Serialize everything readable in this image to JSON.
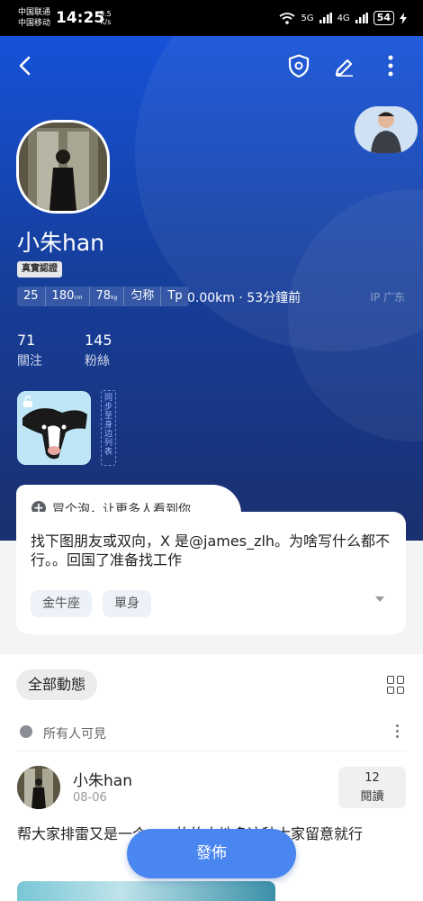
{
  "status_bar": {
    "carrier_1": "中国联通",
    "carrier_2": "中国移动",
    "time": "14:25",
    "net_speed_value": "9.5",
    "net_speed_unit": "K/s",
    "signal_1": "5G",
    "signal_2": "4G",
    "battery": "54"
  },
  "nav": {
    "back_icon": "chevron-left-icon",
    "shield_icon": "shield-icon",
    "edit_icon": "pencil-icon",
    "more_icon": "more-vertical-icon"
  },
  "profile": {
    "nickname": "小朱han",
    "verified_badge": "真實認證",
    "tags": [
      "25",
      "180",
      "78",
      "匀称",
      "Tp"
    ],
    "height_unit": "cm",
    "weight_unit": "kg",
    "distance": "0.00km",
    "separator": "·",
    "last_active": "53分鐘前",
    "ip_location": "IP 广东",
    "following_count": "71",
    "following_label": "關注",
    "followers_count": "145",
    "followers_label": "粉絲",
    "sync_label": "同步至身边列表"
  },
  "bubble": {
    "prompt": "冒个泡，让更多人看到你",
    "bio": "找下图朋友或双向，X 是@james_zlh。为啥写什么都不行。。回国了准备找工作",
    "chips": [
      "金牛座",
      "單身"
    ]
  },
  "feed": {
    "filter_label": "全部動態",
    "visibility": "所有人可見",
    "post": {
      "author": "小朱han",
      "date": "08-06",
      "read_count": "12",
      "read_label": "閱讀",
      "text": "帮大家排雷又是一个……的的本地多这种大家留意就行"
    }
  },
  "publish_button": "發佈",
  "colors": {
    "hero_top": "#1552d9",
    "hero_bottom": "#1a2f6e",
    "accent": "#4a86f0"
  }
}
